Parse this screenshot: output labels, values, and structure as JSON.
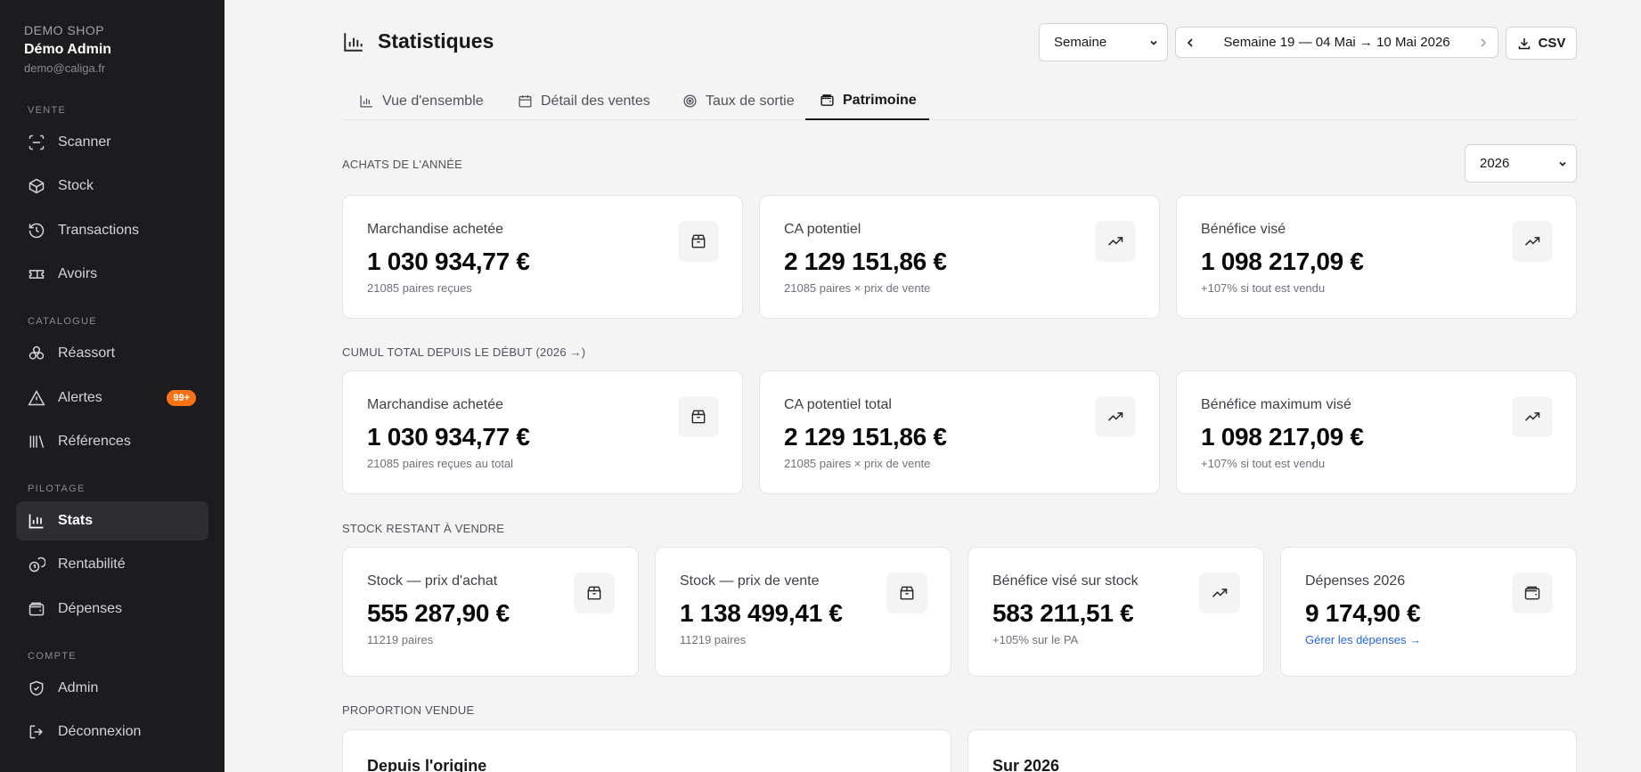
{
  "sidebar": {
    "shop": "DEMO SHOP",
    "user": "Démo Admin",
    "email": "demo@caliga.fr",
    "sections": [
      "VENTE",
      "CATALOGUE",
      "PILOTAGE",
      "COMPTE"
    ],
    "items": [
      {
        "label": "Scanner",
        "icon": "scan-icon"
      },
      {
        "label": "Stock",
        "icon": "box-icon"
      },
      {
        "label": "Transactions",
        "icon": "history-icon"
      },
      {
        "label": "Avoirs",
        "icon": "ticket-icon"
      },
      {
        "label": "Réassort",
        "icon": "boxes-icon"
      },
      {
        "label": "Alertes",
        "icon": "alert-triangle-icon",
        "badge": "99+"
      },
      {
        "label": "Références",
        "icon": "library-icon"
      },
      {
        "label": "Stats",
        "icon": "bar-chart-icon",
        "active": true
      },
      {
        "label": "Rentabilité",
        "icon": "coins-icon"
      },
      {
        "label": "Dépenses",
        "icon": "wallet-icon"
      },
      {
        "label": "Admin",
        "icon": "shield-icon"
      },
      {
        "label": "Déconnexion",
        "icon": "logout-icon"
      }
    ]
  },
  "header": {
    "title": "Statistiques",
    "period": "Semaine",
    "week": "Semaine 19 — 04 Mai → 10 Mai 2026",
    "csv": "CSV"
  },
  "tabs": [
    {
      "label": "Vue d'ensemble",
      "icon": "bar-chart-icon"
    },
    {
      "label": "Détail des ventes",
      "icon": "calendar-icon"
    },
    {
      "label": "Taux de sortie",
      "icon": "target-icon"
    },
    {
      "label": "Patrimoine",
      "icon": "wallet-icon",
      "active": true
    }
  ],
  "year_select": "2026",
  "sections": {
    "achats": {
      "label": "ACHATS DE L'ANNÉE",
      "cards": [
        {
          "label": "Marchandise achetée",
          "value": "1 030 934,77 €",
          "sub": "21085 paires reçues",
          "icon": "package-icon"
        },
        {
          "label": "CA potentiel",
          "value": "2 129 151,86 €",
          "sub": "21085 paires × prix de vente",
          "icon": "trending-up-icon"
        },
        {
          "label": "Bénéfice visé",
          "value": "1 098 217,09 €",
          "sub": "+107% si tout est vendu",
          "icon": "trending-up-icon"
        }
      ]
    },
    "cumul": {
      "label": "CUMUL TOTAL DEPUIS LE DÉBUT (2026 →)",
      "cards": [
        {
          "label": "Marchandise achetée",
          "value": "1 030 934,77 €",
          "sub": "21085 paires reçues au total",
          "icon": "package-icon"
        },
        {
          "label": "CA potentiel total",
          "value": "2 129 151,86 €",
          "sub": "21085 paires × prix de vente",
          "icon": "trending-up-icon"
        },
        {
          "label": "Bénéfice maximum visé",
          "value": "1 098 217,09 €",
          "sub": "+107% si tout est vendu",
          "icon": "trending-up-icon"
        }
      ]
    },
    "stock": {
      "label": "STOCK RESTANT À VENDRE",
      "cards": [
        {
          "label": "Stock — prix d'achat",
          "value": "555 287,90 €",
          "sub": "11219 paires",
          "icon": "package-icon"
        },
        {
          "label": "Stock — prix de vente",
          "value": "1 138 499,41 €",
          "sub": "11219 paires",
          "icon": "package-icon"
        },
        {
          "label": "Bénéfice visé sur stock",
          "value": "583 211,51 €",
          "sub": "+105% sur le PA",
          "icon": "trending-up-icon"
        },
        {
          "label": "Dépenses 2026",
          "value": "9 174,90 €",
          "sub": "Gérer les dépenses →",
          "icon": "wallet-icon"
        }
      ]
    },
    "proportion": {
      "label": "PROPORTION VENDUE",
      "cards": [
        {
          "title": "Depuis l'origine"
        },
        {
          "title": "Sur 2026"
        }
      ]
    }
  }
}
